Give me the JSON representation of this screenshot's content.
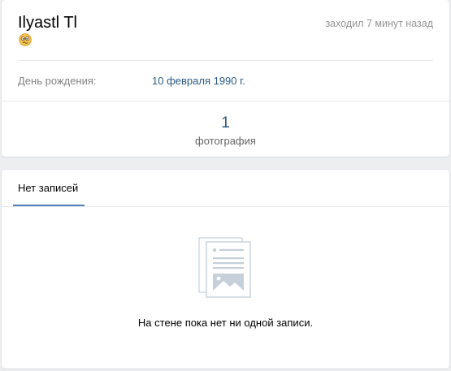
{
  "profile": {
    "name": "Ilyastl Tl",
    "last_seen": "заходил 7 минут назад",
    "status_emoji": "confused-face-icon",
    "info": {
      "birthday_label": "День рождения:",
      "birthday_value": "10 февраля 1990 г."
    },
    "counters": {
      "photos_count": "1",
      "photos_label": "фотография"
    }
  },
  "wall": {
    "tab_label": "Нет записей",
    "empty_icon": "document-image-icon",
    "empty_text": "На стене пока нет ни одной записи."
  },
  "colors": {
    "background": "#edeef0",
    "link": "#2a5885",
    "muted": "#939393",
    "accent": "#5181b8"
  }
}
